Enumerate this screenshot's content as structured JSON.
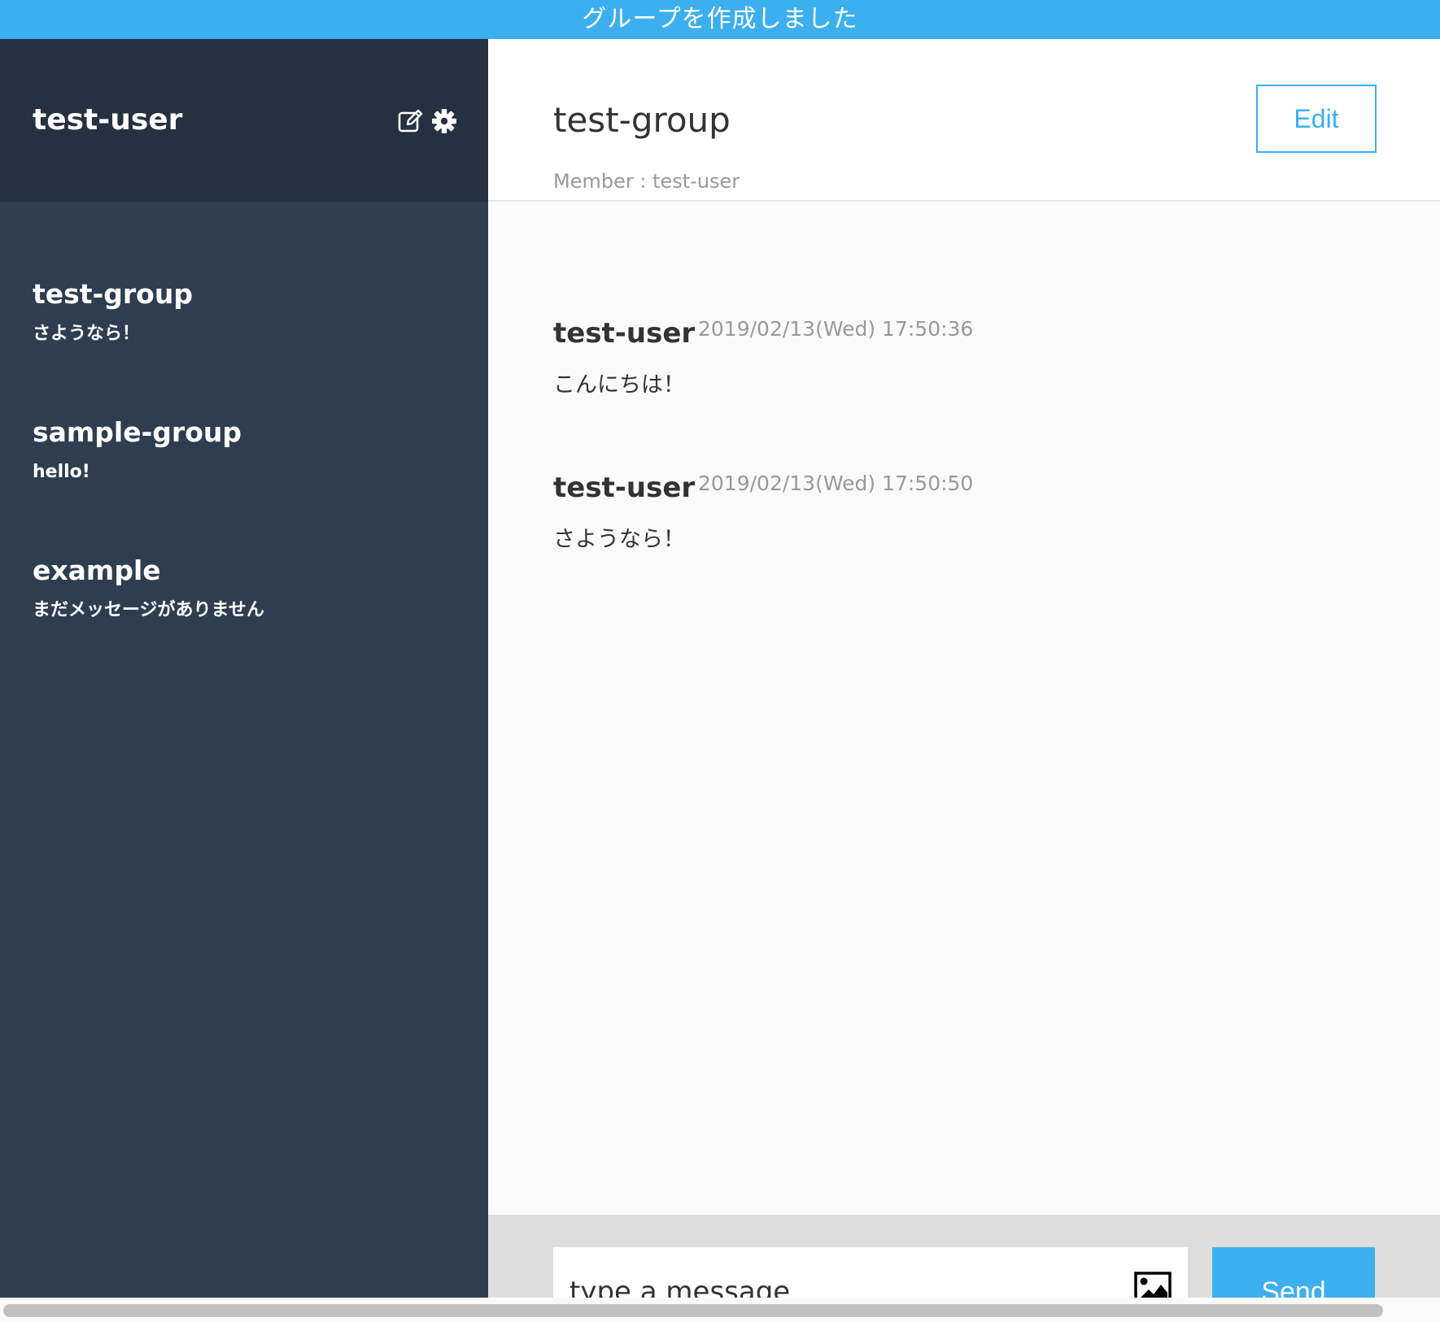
{
  "notice": {
    "text": "グループを作成しました"
  },
  "sidebar": {
    "current_user": "test-user",
    "icons": [
      "edit-icon",
      "gear-icon"
    ],
    "groups": [
      {
        "name": "test-group",
        "last_message": "さようなら！"
      },
      {
        "name": "sample-group",
        "last_message": "hello!"
      },
      {
        "name": "example",
        "last_message": "まだメッセージがありません"
      }
    ]
  },
  "main": {
    "group_name": "test-group",
    "member_line": "Member : test-user",
    "edit_label": "Edit",
    "messages": [
      {
        "user": "test-user",
        "time": "2019/02/13(Wed) 17:50:36",
        "text": "こんにちは！"
      },
      {
        "user": "test-user",
        "time": "2019/02/13(Wed) 17:50:50",
        "text": "さようなら！"
      }
    ]
  },
  "form": {
    "placeholder": "type a message",
    "image_icon": "image-icon",
    "send_label": "Send"
  },
  "colors": {
    "accent": "#3caff0",
    "sidebar_bg": "#2e3e50",
    "sidebar_header_bg": "#253141"
  }
}
